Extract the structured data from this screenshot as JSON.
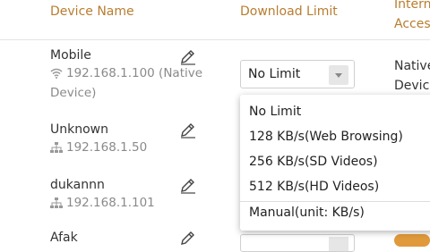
{
  "header": {
    "device_name": "Device Name",
    "download_limit": "Download Limit",
    "internet_access_line1": "Interne",
    "internet_access_line2": "Acces"
  },
  "devices": [
    {
      "name": "Mobile",
      "ip": "192.168.1.100 (Native",
      "ip_cont": "Device)",
      "connection": "wifi-icon"
    },
    {
      "name": "Unknown",
      "ip": "192.168.1.50",
      "connection": "lan-icon"
    },
    {
      "name": "dukannn",
      "ip": "192.168.1.101",
      "connection": "lan-icon"
    },
    {
      "name": "Afak",
      "connection": "lan-icon"
    }
  ],
  "select": {
    "value": "No Limit"
  },
  "right_col": {
    "line1": "Native",
    "line2": "Device"
  },
  "dropdown": {
    "options": [
      "No Limit",
      "128 KB/s(Web Browsing)",
      "256 KB/s(SD Videos)",
      "512 KB/s(HD Videos)",
      "Manual(unit: KB/s)"
    ]
  },
  "colors": {
    "header_text": "#b87d2f",
    "toggle_on": "#e09a3c"
  }
}
